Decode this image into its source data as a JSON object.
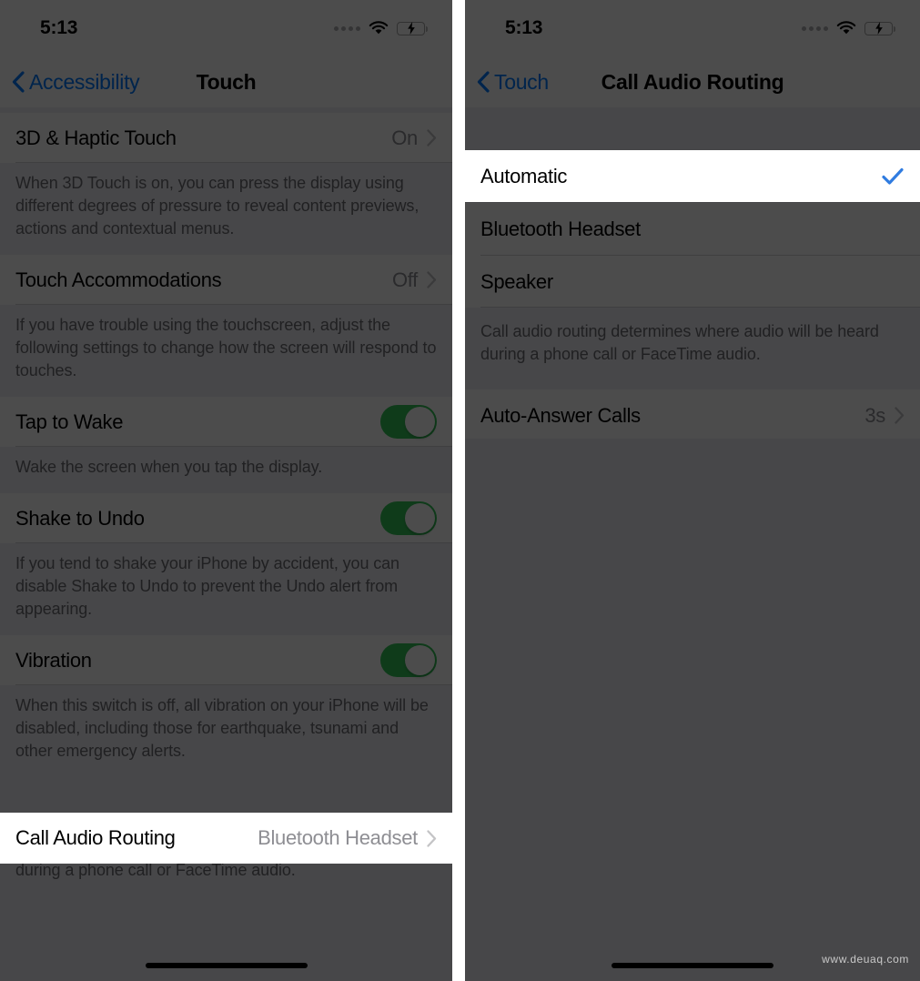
{
  "watermark": "www.deuaq.com",
  "colors": {
    "accent_blue": "#007aff",
    "toggle_green": "#34c759",
    "group_background": "#efeff4",
    "row_background": "#ffffff",
    "secondary_text": "#8e8e93",
    "footer_text": "#6d6d72",
    "dim_overlay": "rgba(0,0,0,0.70)"
  },
  "status_bar": {
    "time": "5:13",
    "signal_icon": "signal-dots-icon",
    "wifi_icon": "wifi-icon",
    "battery_icon": "battery-charging-icon"
  },
  "left_panel": {
    "nav": {
      "back_icon": "chevron-left-icon",
      "back_label": "Accessibility",
      "title": "Touch"
    },
    "rows": [
      {
        "type": "disclosure",
        "label": "3D & Haptic Touch",
        "value": "On",
        "chevron_icon": "chevron-right-icon",
        "highlighted": false
      },
      {
        "type": "footer",
        "text": "When 3D Touch is on, you can press the display using different degrees of pressure to reveal content previews, actions and contextual menus."
      },
      {
        "type": "disclosure",
        "label": "Touch Accommodations",
        "value": "Off",
        "chevron_icon": "chevron-right-icon",
        "highlighted": false
      },
      {
        "type": "footer",
        "text": "If you have trouble using the touchscreen, adjust the following settings to change how the screen will respond to touches."
      },
      {
        "type": "toggle",
        "label": "Tap to Wake",
        "toggle_on": true,
        "highlighted": false
      },
      {
        "type": "footer",
        "text": "Wake the screen when you tap the display."
      },
      {
        "type": "toggle",
        "label": "Shake to Undo",
        "toggle_on": true,
        "highlighted": false
      },
      {
        "type": "footer",
        "text": "If you tend to shake your iPhone by accident, you can disable Shake to Undo to prevent the Undo alert from appearing."
      },
      {
        "type": "toggle",
        "label": "Vibration",
        "toggle_on": true,
        "highlighted": false
      },
      {
        "type": "footer",
        "text": "When this switch is off, all vibration on your iPhone will be disabled, including those for earthquake, tsunami and other emergency alerts."
      },
      {
        "type": "disclosure",
        "label": "Call Audio Routing",
        "value": "Bluetooth Headset",
        "chevron_icon": "chevron-right-icon",
        "highlighted": true
      },
      {
        "type": "footer",
        "text": "Call audio routing determines where audio will be heard during a phone call or FaceTime audio."
      }
    ]
  },
  "right_panel": {
    "nav": {
      "back_icon": "chevron-left-icon",
      "back_label": "Touch",
      "title": "Call Audio Routing"
    },
    "rows": [
      {
        "type": "check",
        "label": "Automatic",
        "checked": true,
        "check_icon": "checkmark-icon",
        "highlighted": true
      },
      {
        "type": "check",
        "label": "Bluetooth Headset",
        "checked": false,
        "highlighted": false
      },
      {
        "type": "check",
        "label": "Speaker",
        "checked": false,
        "highlighted": false
      },
      {
        "type": "footer",
        "text": "Call audio routing determines where audio will be heard during a phone call or FaceTime audio."
      },
      {
        "type": "disclosure",
        "label": "Auto-Answer Calls",
        "value": "3s",
        "chevron_icon": "chevron-right-icon",
        "highlighted": false
      }
    ]
  }
}
